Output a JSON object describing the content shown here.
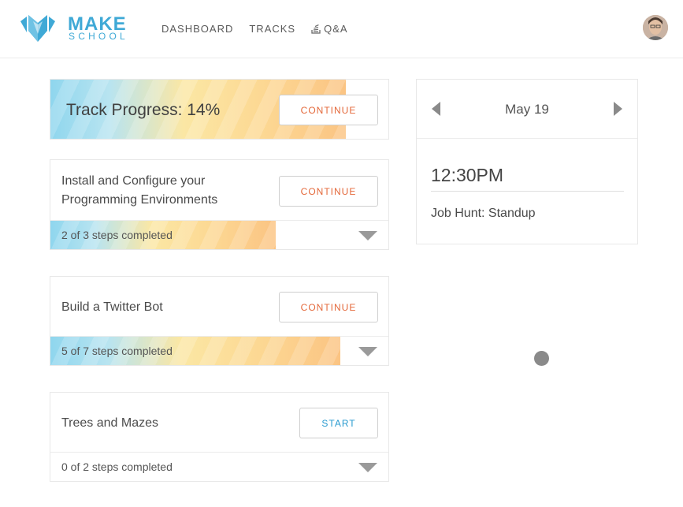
{
  "header": {
    "logo_make": "MAKE",
    "logo_school": "SCHOOL",
    "nav": [
      {
        "label": "DASHBOARD"
      },
      {
        "label": "TRACKS"
      },
      {
        "label": "Q&A",
        "icon": "stack-icon"
      }
    ]
  },
  "track": {
    "title": "Track Progress: 14%",
    "button": "CONTINUE",
    "progress_fraction": 0.875
  },
  "lessons": [
    {
      "title_line1": "Install and Configure your",
      "title_line2": "Programming Environments",
      "button": "CONTINUE",
      "steps": "2 of 3 steps completed",
      "progress_fraction": 0.667
    },
    {
      "title_line1": "Build a Twitter Bot",
      "button": "CONTINUE",
      "steps": "5 of 7 steps completed",
      "progress_fraction": 0.857
    },
    {
      "title_line1": "Trees and Mazes",
      "button": "START",
      "steps": "0 of 2 steps completed",
      "progress_fraction": 0
    }
  ],
  "calendar": {
    "date": "May 19",
    "time": "12:30PM",
    "event": "Job Hunt: Standup"
  },
  "colors": {
    "brand": "#3fa9d6",
    "continue": "#e4683a",
    "start": "#2a9bd0"
  }
}
